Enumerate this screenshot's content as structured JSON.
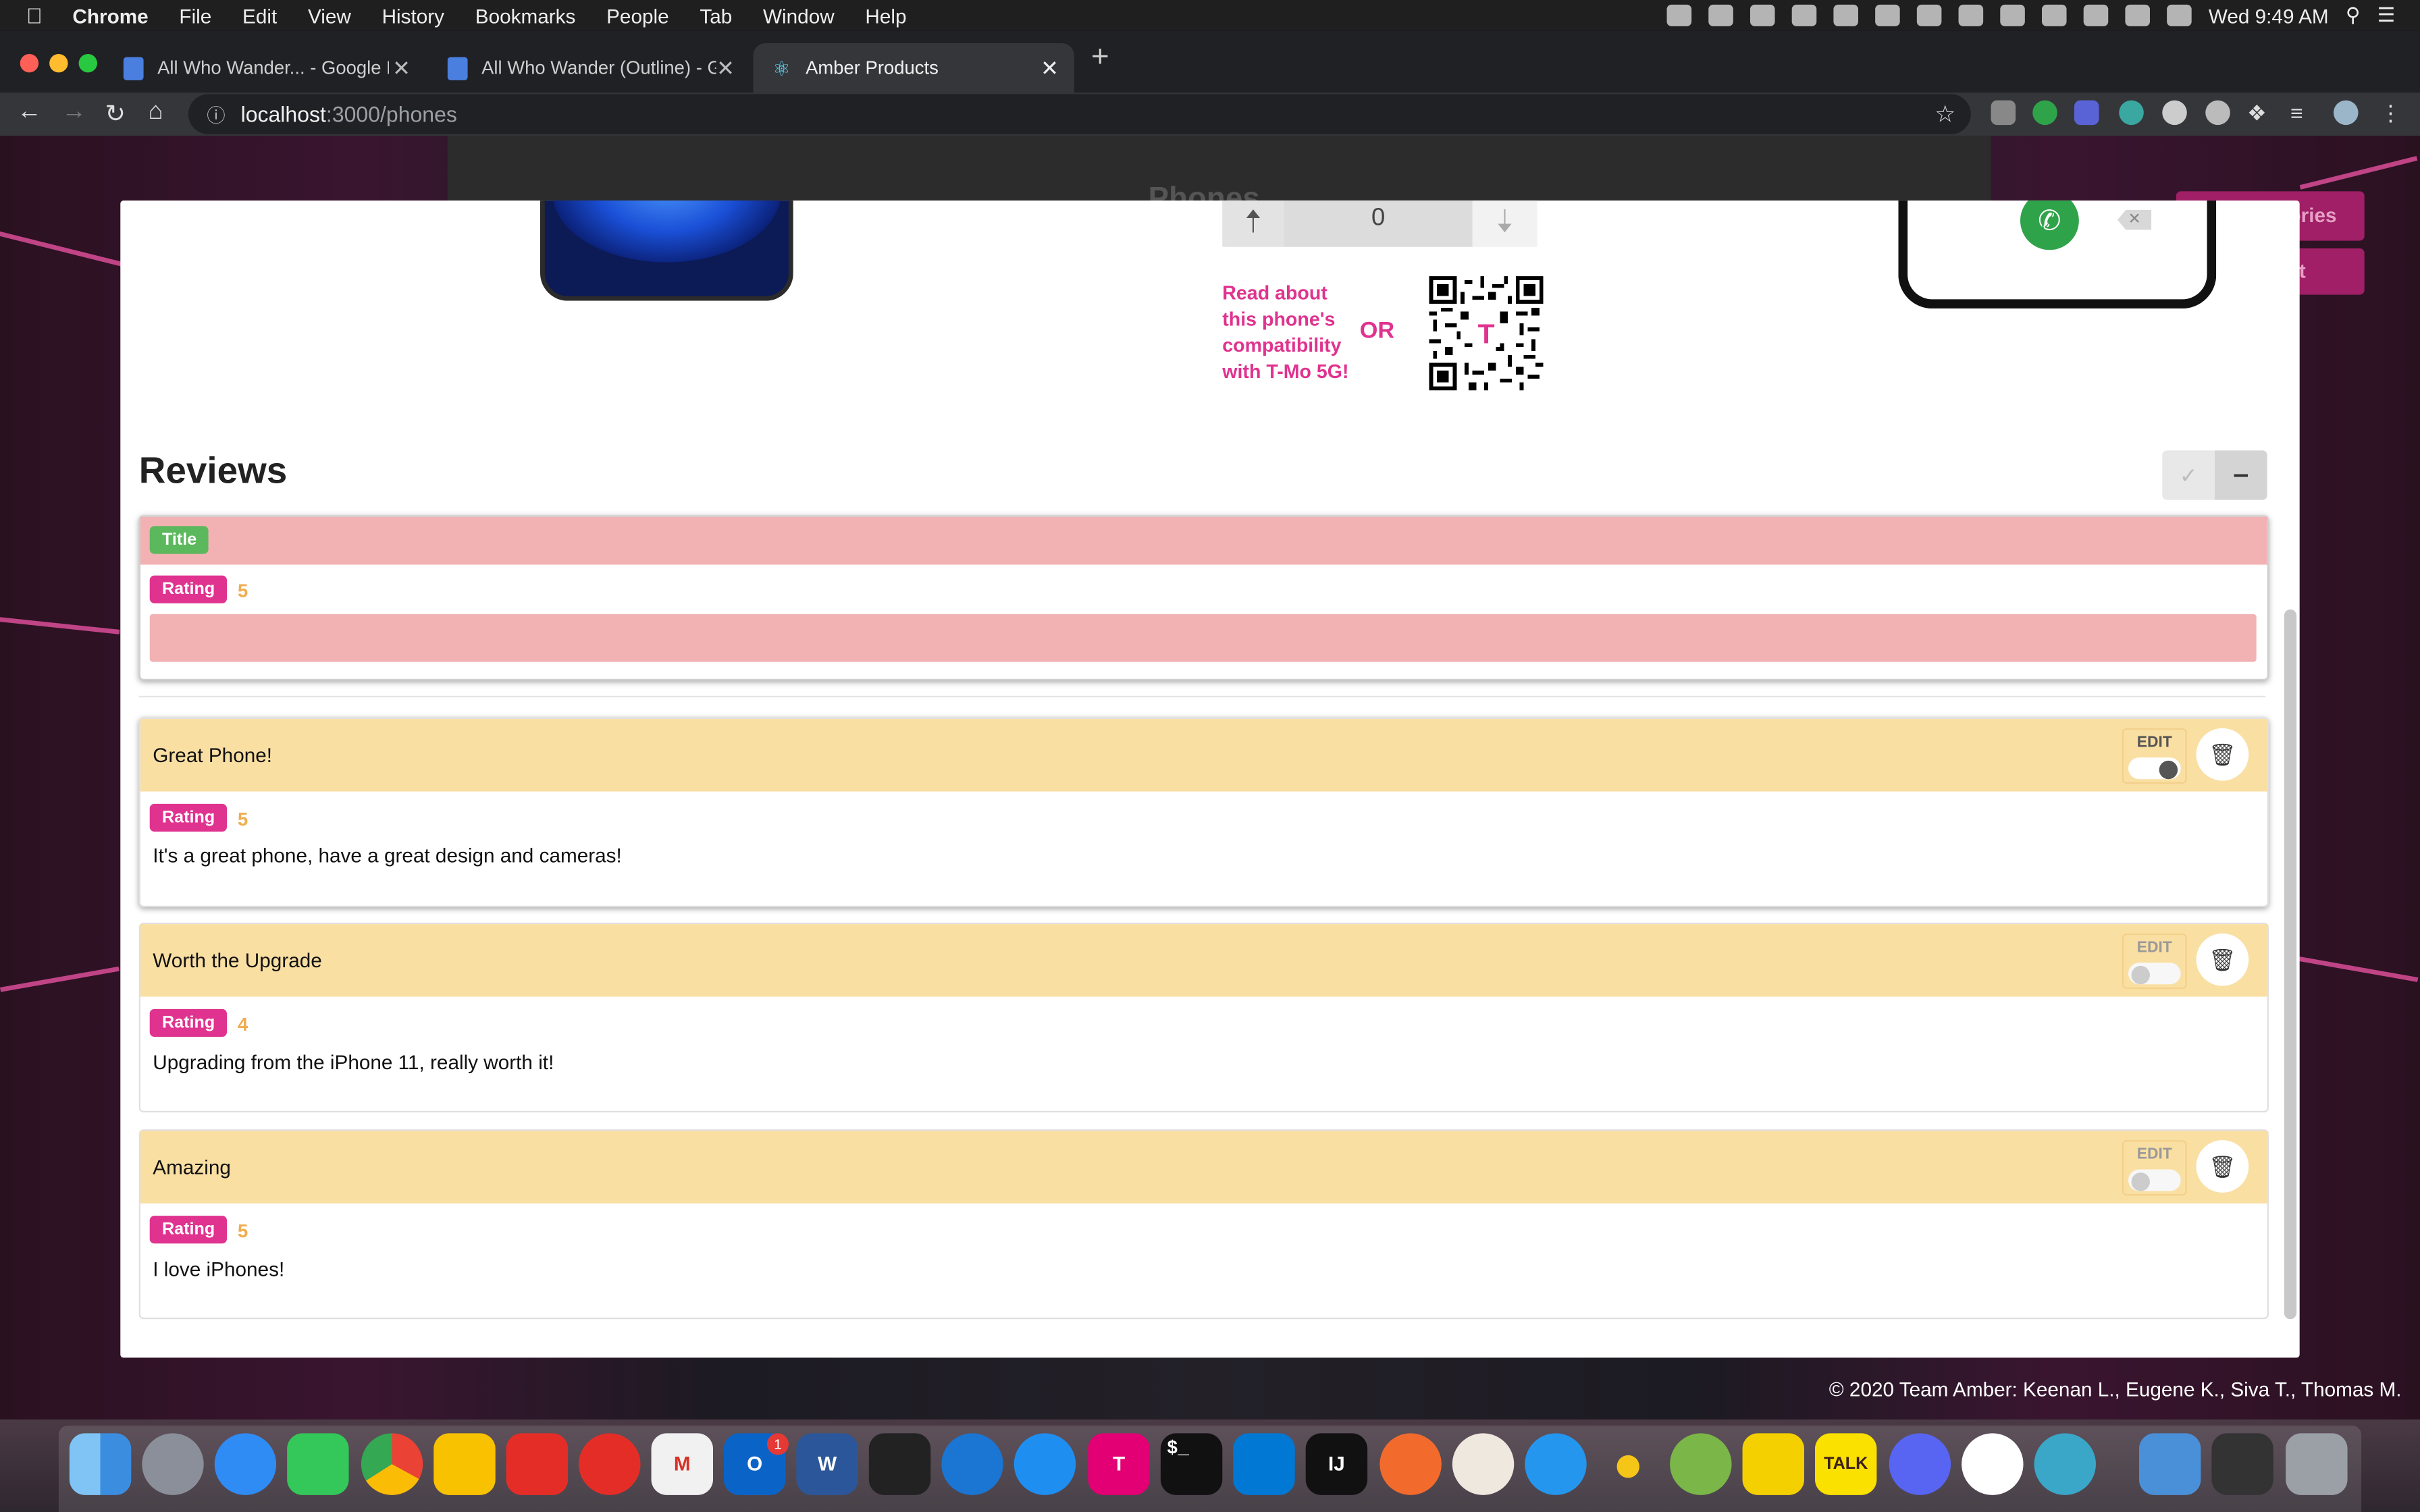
{
  "menubar": {
    "app": "Chrome",
    "items": [
      "File",
      "Edit",
      "View",
      "History",
      "Bookmarks",
      "People",
      "Tab",
      "Window",
      "Help"
    ],
    "clock": "Wed 9:49 AM"
  },
  "tabs": [
    {
      "label": "All Who Wander... - Google Do",
      "active": false
    },
    {
      "label": "All Who Wander (Outline) - Go",
      "active": false
    },
    {
      "label": "Amber Products",
      "active": true
    }
  ],
  "address": {
    "host": "localhost",
    "path": ":3000/phones"
  },
  "background": {
    "title": "Phones",
    "btn1": "ories",
    "btn2": "t"
  },
  "phone": {
    "vote_count": "0",
    "compat_text": "Read about this phone's compatibility with T-Mo 5G!",
    "or_text": "OR"
  },
  "reviews": {
    "heading": "Reviews",
    "new_review": {
      "title_pill": "Title",
      "rating_pill": "Rating",
      "rating_value": "5"
    },
    "items": [
      {
        "title": "Great Phone!",
        "rating_label": "Rating",
        "rating": "5",
        "text": "It's a great phone, have a great design and cameras!",
        "edit_label": "EDIT",
        "edit_on": true
      },
      {
        "title": "Worth the Upgrade",
        "rating_label": "Rating",
        "rating": "4",
        "text": "Upgrading from the iPhone 11, really worth it!",
        "edit_label": "EDIT",
        "edit_on": false
      },
      {
        "title": "Amazing",
        "rating_label": "Rating",
        "rating": "5",
        "text": "I love iPhones!",
        "edit_label": "EDIT",
        "edit_on": false
      }
    ]
  },
  "footer": "© 2020 Team Amber: Keenan L., Eugene K., Siva T., Thomas M.",
  "dock": {
    "outlook_badge": "1",
    "word_letter": "W",
    "outlook_letter": "O",
    "talk_label": "TALK",
    "intellij_label": "IJ",
    "terminal_label": "$_"
  },
  "colors": {
    "accent_pink": "#e0338f",
    "rating_gold": "#f0ad4e",
    "card_header": "#fadfa3",
    "invalid_field": "#f2b2b4",
    "title_pill": "#5cb85c"
  }
}
